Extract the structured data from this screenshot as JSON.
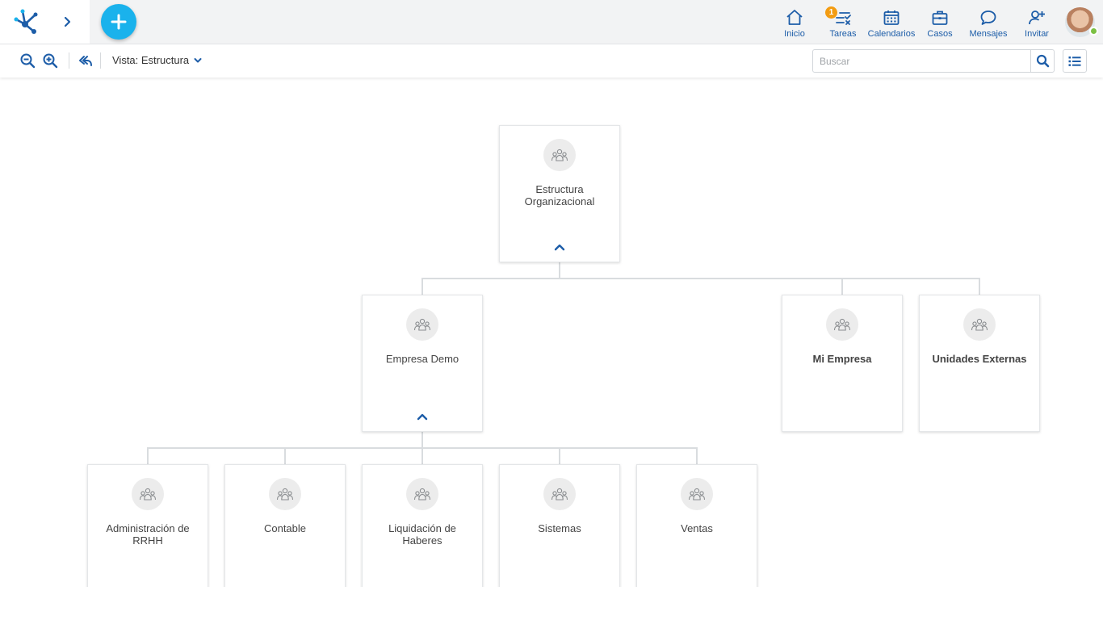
{
  "nav": {
    "items": [
      {
        "key": "inicio",
        "label": "Inicio",
        "icon": "home-icon"
      },
      {
        "key": "tareas",
        "label": "Tareas",
        "icon": "tasks-icon",
        "badge": "1"
      },
      {
        "key": "calendarios",
        "label": "Calendarios",
        "icon": "calendar-icon"
      },
      {
        "key": "casos",
        "label": "Casos",
        "icon": "briefcase-icon"
      },
      {
        "key": "mensajes",
        "label": "Mensajes",
        "icon": "chat-icon"
      },
      {
        "key": "invitar",
        "label": "Invitar",
        "icon": "add-user-icon"
      }
    ]
  },
  "toolbar": {
    "view_label": "Vista: Estructura",
    "search_placeholder": "Buscar"
  },
  "colors": {
    "accent": "#1d5da8",
    "add_button": "#1ab2ec",
    "badge": "#f39c12",
    "online": "#7bc043"
  },
  "tree": {
    "root": {
      "label": "Estructura Organizacional"
    },
    "level1": [
      {
        "label": "Empresa Demo"
      },
      {
        "label": "Mi Empresa"
      },
      {
        "label": "Unidades Externas"
      }
    ],
    "level2": [
      {
        "label": "Administración de RRHH"
      },
      {
        "label": "Contable"
      },
      {
        "label": "Liquidación de Haberes"
      },
      {
        "label": "Sistemas"
      },
      {
        "label": "Ventas"
      }
    ]
  }
}
